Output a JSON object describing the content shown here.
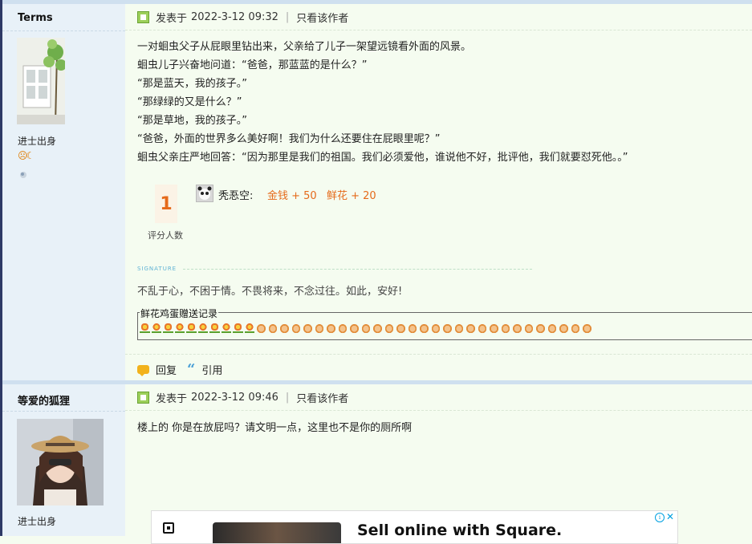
{
  "posts": [
    {
      "author": "Terms",
      "rank": "进士出身",
      "medals": "☹☾",
      "header": {
        "posted_label": "发表于",
        "datetime": "2022-3-12 09:32",
        "only_author": "只看该作者"
      },
      "content": [
        "一对蛔虫父子从屁眼里钻出来，父亲给了儿子一架望远镜看外面的风景。",
        "蛔虫儿子兴奋地问道：“爸爸，那蓝蓝的是什么？”",
        "“那是蓝天，我的孩子。”",
        "“那绿绿的又是什么？”",
        "“那是草地，我的孩子。”",
        "“爸爸，外面的世界多么美好啊！我们为什么还要住在屁眼里呢？”",
        "蛔虫父亲庄严地回答：“因为那里是我们的祖国。我们必须爱他，谁说他不好，批评他，我们就要怼死他。。”"
      ],
      "rating": {
        "count": "1",
        "count_label": "评分人数",
        "rater": "秃忢空:",
        "rewards": [
          "金钱 + 50",
          "鲜花 + 20"
        ]
      },
      "signature": {
        "tag": "SIGNATURE",
        "text": "不乱于心，不困于情。不畏将来，不念过往。如此，安好!"
      },
      "gift_box": {
        "legend": "鲜花鸡蛋赠送记录",
        "flowers": 10,
        "eggs": 29
      },
      "actions": {
        "reply": "回复",
        "quote": "引用"
      }
    },
    {
      "author": "等爱的狐狸",
      "rank": "进士出身",
      "header": {
        "posted_label": "发表于",
        "datetime": "2022-3-12 09:46",
        "only_author": "只看该作者"
      },
      "content": [
        "楼上的 你是在放屁吗？请文明一点，这里也不是你的厕所啊"
      ]
    }
  ],
  "ad": {
    "text": "Sell online with Square.",
    "info": "i",
    "close": "✕"
  }
}
